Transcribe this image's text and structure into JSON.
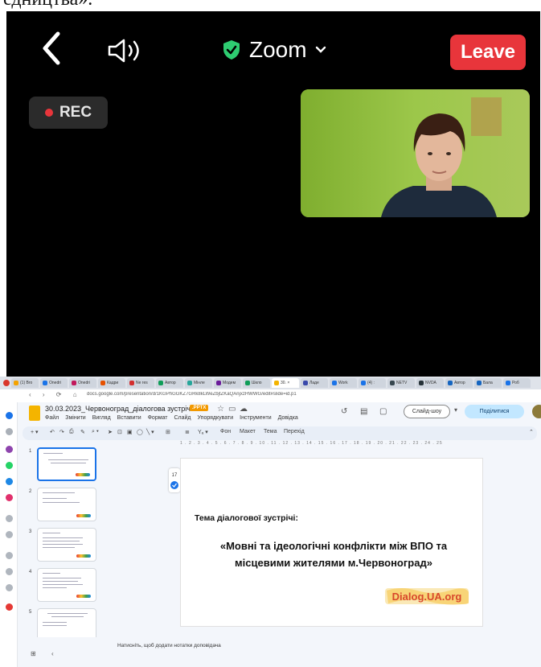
{
  "caption_fragment": "едництва».",
  "zoom": {
    "title": "Zoom",
    "leave_label": "Leave",
    "rec_label": "REC",
    "icons": [
      "back-chevron-icon",
      "speaker-icon",
      "shield-check-icon",
      "chevron-down-icon"
    ],
    "colors": {
      "leave": "#e8353b",
      "shield": "#2ecc71",
      "background": "#000000"
    }
  },
  "browser": {
    "url": "docs.google.com/presentation/d/1KGPhGGKZ7GRk8kLWeZbjtZKaQAnjxzHWWG/edit#slide=id.p1",
    "tabs": [
      "(1) Bro",
      "Onedri",
      "Onedri",
      "Кадри",
      "Ne res",
      "Автор",
      "Мінле",
      "Модем",
      "Шкло",
      "30. ×",
      "Ладе",
      "Work",
      "(4) :",
      "NETV",
      "NVDA",
      "Автор",
      "Бала",
      "Роб"
    ]
  },
  "slides": {
    "doc_title": "30.03.2023_Червоноград_діалогова зустріч",
    "file_badge": ".PPTX",
    "menu": [
      "Файл",
      "Змінити",
      "Вигляд",
      "Вставити",
      "Формат",
      "Слайд",
      "Упорядкувати",
      "Інструменти",
      "Довідка"
    ],
    "slideshow_label": "Слайд-шоу",
    "share_label": "Поділитися",
    "toolbar": {
      "background": "Фон",
      "layout": "Макет",
      "theme": "Тема",
      "transition": "Перехід"
    },
    "ruler_ticks": "1 . 2 . 3 . 4 . 5 . 6 . 7 . 8 . 9 . 10 . 11 . 12 . 13 . 14 . 15 . 16 . 17 . 18 . 19 . 20 . 21 . 22 . 23 . 24 . 25",
    "thumbnail_numbers": [
      "1",
      "2",
      "3",
      "4",
      "5"
    ],
    "current_slide": {
      "label": "Тема діалогової зустрічі:",
      "topic": "«Мовні та ідеологічні конфлікти між ВПО та місцевими жителями м.Червоноград»",
      "logo_text": "Dialog.UA.org"
    },
    "notes_placeholder": "Натисніть, щоб додати нотатки доповідача"
  }
}
